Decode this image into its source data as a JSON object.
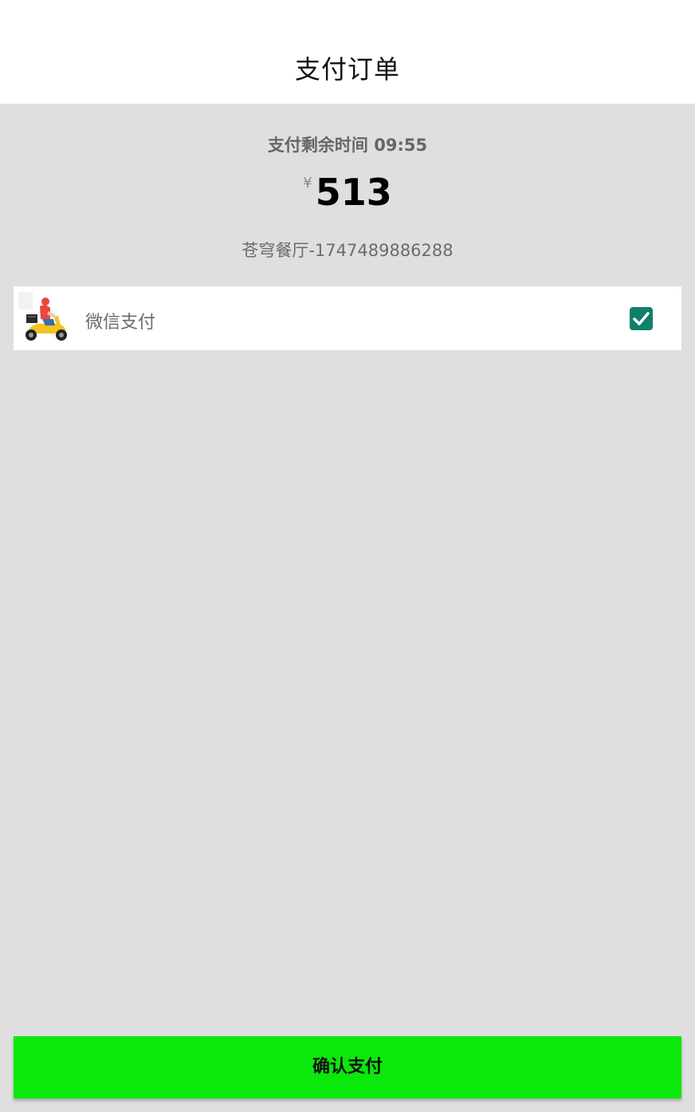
{
  "header": {
    "title": "支付订单"
  },
  "summary": {
    "countdown": "支付剩余时间 09:55",
    "currency_symbol": "¥",
    "amount": "513",
    "order_ref": "苍穹餐厅-1747489886288"
  },
  "payment_option": {
    "label": "微信支付",
    "logo_icon": "scooter-courier-icon",
    "checked": true,
    "check_color": "#0f7f6b"
  },
  "footer": {
    "confirm_label": "确认支付",
    "confirm_color": "#0be80b"
  },
  "colors": {
    "background": "#dfdfdf",
    "header_background": "#ffffff"
  }
}
